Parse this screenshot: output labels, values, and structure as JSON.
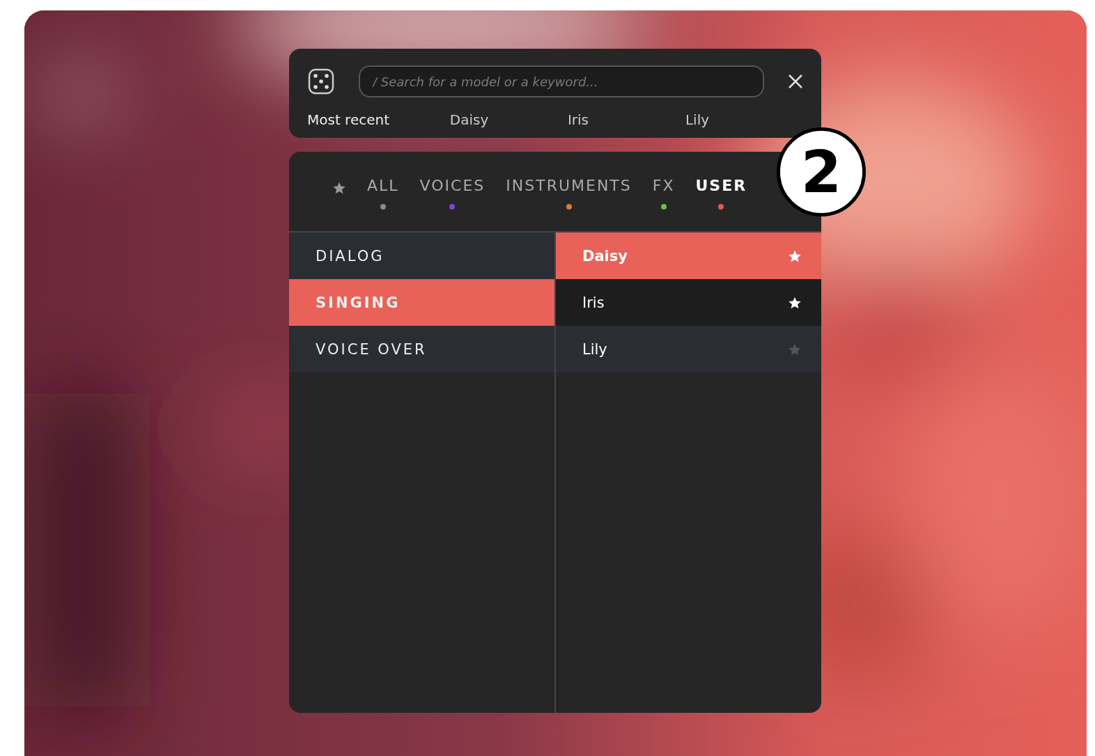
{
  "search": {
    "placeholder": "/ Search for a model or a keyword..."
  },
  "recent": {
    "label": "Most recent",
    "items": [
      "Daisy",
      "Iris",
      "Lily"
    ]
  },
  "tabs": [
    {
      "kind": "favorites",
      "selected": false
    },
    {
      "kind": "label",
      "label": "ALL",
      "color": "#8a8a8a",
      "selected": false
    },
    {
      "kind": "label",
      "label": "VOICES",
      "color": "#8a3ee0",
      "selected": false
    },
    {
      "kind": "label",
      "label": "INSTRUMENTS",
      "color": "#e07a30",
      "selected": false
    },
    {
      "kind": "label",
      "label": "FX",
      "color": "#6cc04a",
      "selected": false
    },
    {
      "kind": "label",
      "label": "USER",
      "color": "#e8594f",
      "selected": true
    }
  ],
  "categories": [
    {
      "label": "DIALOG",
      "selected": false
    },
    {
      "label": "SINGING",
      "selected": true
    },
    {
      "label": "VOICE OVER",
      "selected": false
    }
  ],
  "models": [
    {
      "name": "Daisy",
      "selected": true,
      "highlighted": false,
      "favorite": true
    },
    {
      "name": "Iris",
      "selected": false,
      "highlighted": true,
      "favorite": true
    },
    {
      "name": "Lily",
      "selected": false,
      "highlighted": false,
      "favorite": false
    }
  ],
  "step_badge": "2"
}
